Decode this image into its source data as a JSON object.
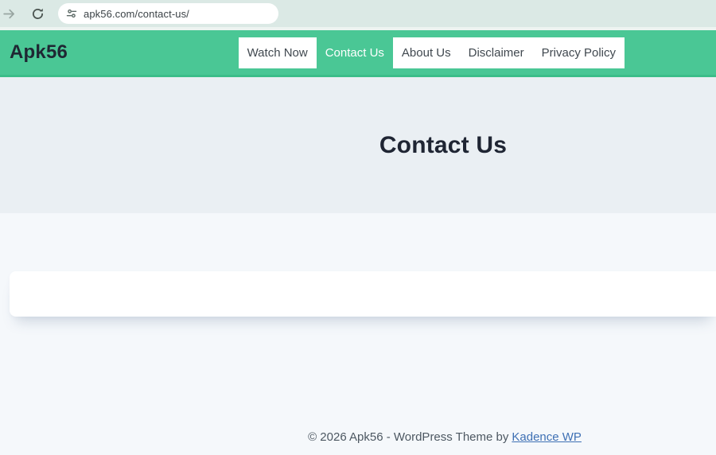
{
  "browser": {
    "url": "apk56.com/contact-us/"
  },
  "header": {
    "logo": "Apk56",
    "nav": [
      {
        "label": "Watch Now",
        "active": false
      },
      {
        "label": "Contact Us",
        "active": true
      },
      {
        "label": "About Us",
        "active": false
      },
      {
        "label": "Disclaimer",
        "active": false
      },
      {
        "label": "Privacy Policy",
        "active": false
      }
    ]
  },
  "hero": {
    "title": "Contact Us"
  },
  "footer": {
    "copyright": "© 2026 Apk56 - WordPress Theme by",
    "link_label": "Kadence WP"
  },
  "colors": {
    "accent_green": "#4ac795",
    "header_border_green": "#3cbd89",
    "hero_bg": "#eaeff3",
    "page_bg": "#f5f8fb",
    "toolbar_bg": "#dbe9e5",
    "link_blue": "#3e70b4",
    "heading_text": "#1f2533"
  }
}
